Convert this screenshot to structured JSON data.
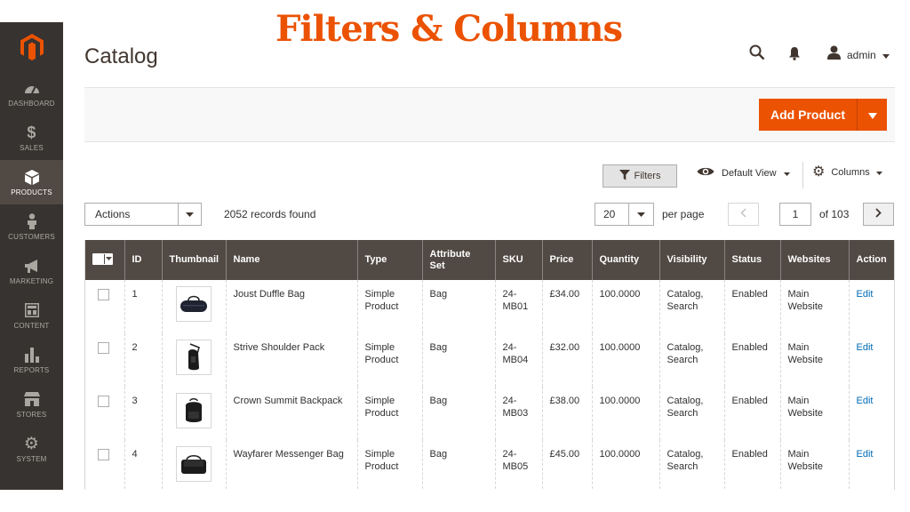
{
  "overlay_title": "Filters & Columns",
  "sidebar": {
    "items": [
      {
        "label": "DASHBOARD",
        "icon": "dashboard-icon"
      },
      {
        "label": "SALES",
        "icon": "dollar-icon"
      },
      {
        "label": "PRODUCTS",
        "icon": "cube-icon",
        "active": true
      },
      {
        "label": "CUSTOMERS",
        "icon": "person-icon"
      },
      {
        "label": "MARKETING",
        "icon": "megaphone-icon"
      },
      {
        "label": "CONTENT",
        "icon": "layout-icon"
      },
      {
        "label": "REPORTS",
        "icon": "bar-chart-icon"
      },
      {
        "label": "STORES",
        "icon": "store-icon"
      },
      {
        "label": "SYSTEM",
        "icon": "gear-icon"
      }
    ]
  },
  "header": {
    "title": "Catalog",
    "user": "admin"
  },
  "add_product": {
    "label": "Add Product"
  },
  "toolbar": {
    "filters_label": "Filters",
    "view_label": "Default View",
    "columns_label": "Columns",
    "actions_label": "Actions",
    "records_found": "2052 records found",
    "per_page_value": "20",
    "per_page_label": "per page",
    "current_page": "1",
    "of_pages": "of 103"
  },
  "grid": {
    "columns": [
      "ID",
      "Thumbnail",
      "Name",
      "Type",
      "Attribute Set",
      "SKU",
      "Price",
      "Quantity",
      "Visibility",
      "Status",
      "Websites",
      "Action"
    ],
    "rows": [
      {
        "id": "1",
        "name": "Joust Duffle Bag",
        "type": "Simple Product",
        "attribute_set": "Bag",
        "sku": "24-MB01",
        "price": "£34.00",
        "quantity": "100.0000",
        "visibility": "Catalog, Search",
        "status": "Enabled",
        "websites": "Main Website",
        "action": "Edit",
        "thumb": "duffle-bag-icon"
      },
      {
        "id": "2",
        "name": "Strive Shoulder Pack",
        "type": "Simple Product",
        "attribute_set": "Bag",
        "sku": "24-MB04",
        "price": "£32.00",
        "quantity": "100.0000",
        "visibility": "Catalog, Search",
        "status": "Enabled",
        "websites": "Main Website",
        "action": "Edit",
        "thumb": "shoulder-pack-icon"
      },
      {
        "id": "3",
        "name": "Crown Summit Backpack",
        "type": "Simple Product",
        "attribute_set": "Bag",
        "sku": "24-MB03",
        "price": "£38.00",
        "quantity": "100.0000",
        "visibility": "Catalog, Search",
        "status": "Enabled",
        "websites": "Main Website",
        "action": "Edit",
        "thumb": "backpack-icon"
      },
      {
        "id": "4",
        "name": "Wayfarer Messenger Bag",
        "type": "Simple Product",
        "attribute_set": "Bag",
        "sku": "24-MB05",
        "price": "£45.00",
        "quantity": "100.0000",
        "visibility": "Catalog, Search",
        "status": "Enabled",
        "websites": "Main Website",
        "action": "Edit",
        "thumb": "messenger-bag-icon"
      }
    ]
  },
  "colors": {
    "accent": "#eb5202",
    "sidebar_bg": "#373330",
    "grid_header_bg": "#514943",
    "link": "#006bb4"
  }
}
